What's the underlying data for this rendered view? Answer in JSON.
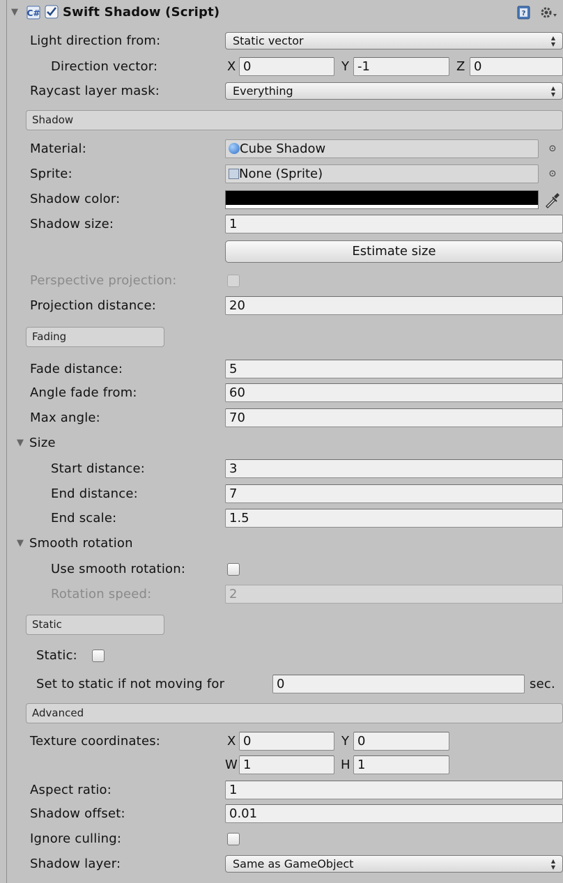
{
  "header": {
    "title": "Swift Shadow (Script)"
  },
  "general": {
    "light_direction_label": "Light direction from:",
    "light_direction_value": "Static vector",
    "direction_vector_label": "Direction vector:",
    "vec_x": "X",
    "vec_x_val": "0",
    "vec_y": "Y",
    "vec_y_val": "-1",
    "vec_z": "Z",
    "vec_z_val": "0",
    "raycast_label": "Raycast layer mask:",
    "raycast_value": "Everything"
  },
  "shadow": {
    "section": "Shadow",
    "material_label": "Material:",
    "material_value": "Cube Shadow",
    "sprite_label": "Sprite:",
    "sprite_value": "None (Sprite)",
    "color_label": "Shadow color:",
    "size_label": "Shadow size:",
    "size_value": "1",
    "estimate_button": "Estimate size",
    "perspective_label": "Perspective projection:",
    "projection_distance_label": "Projection distance:",
    "projection_distance_value": "20"
  },
  "fading": {
    "section": "Fading",
    "fade_distance_label": "Fade distance:",
    "fade_distance_value": "5",
    "angle_fade_label": "Angle fade from:",
    "angle_fade_value": "60",
    "max_angle_label": "Max angle:",
    "max_angle_value": "70"
  },
  "size": {
    "foldout": "Size",
    "start_label": "Start distance:",
    "start_value": "3",
    "end_label": "End distance:",
    "end_value": "7",
    "scale_label": "End scale:",
    "scale_value": "1.5"
  },
  "smooth": {
    "foldout": "Smooth rotation",
    "use_label": "Use smooth rotation:",
    "speed_label": "Rotation speed:",
    "speed_value": "2"
  },
  "static": {
    "section": "Static",
    "static_label": "Static:",
    "set_static_label": "Set to static if not moving for",
    "set_static_value": "0",
    "sec_label": "sec."
  },
  "advanced": {
    "section": "Advanced",
    "tex_label": "Texture coordinates:",
    "tex_x": "X",
    "tex_x_val": "0",
    "tex_y": "Y",
    "tex_y_val": "0",
    "tex_w": "W",
    "tex_w_val": "1",
    "tex_h": "H",
    "tex_h_val": "1",
    "aspect_label": "Aspect ratio:",
    "aspect_value": "1",
    "offset_label": "Shadow offset:",
    "offset_value": "0.01",
    "ignore_culling_label": "Ignore culling:",
    "layer_label": "Shadow layer:",
    "layer_value": "Same as GameObject"
  },
  "colors": {
    "shadow_color": "#000000",
    "panel_bg": "#c2c2c2",
    "field_bg": "#efefef"
  },
  "icons": [
    "foldout-arrow-icon",
    "script-icon",
    "checkbox-checked-icon",
    "help-book-icon",
    "gear-icon",
    "material-sphere-icon",
    "sprite-icon",
    "object-picker-icon",
    "eyedropper-icon",
    "dropdown-arrows-icon"
  ]
}
